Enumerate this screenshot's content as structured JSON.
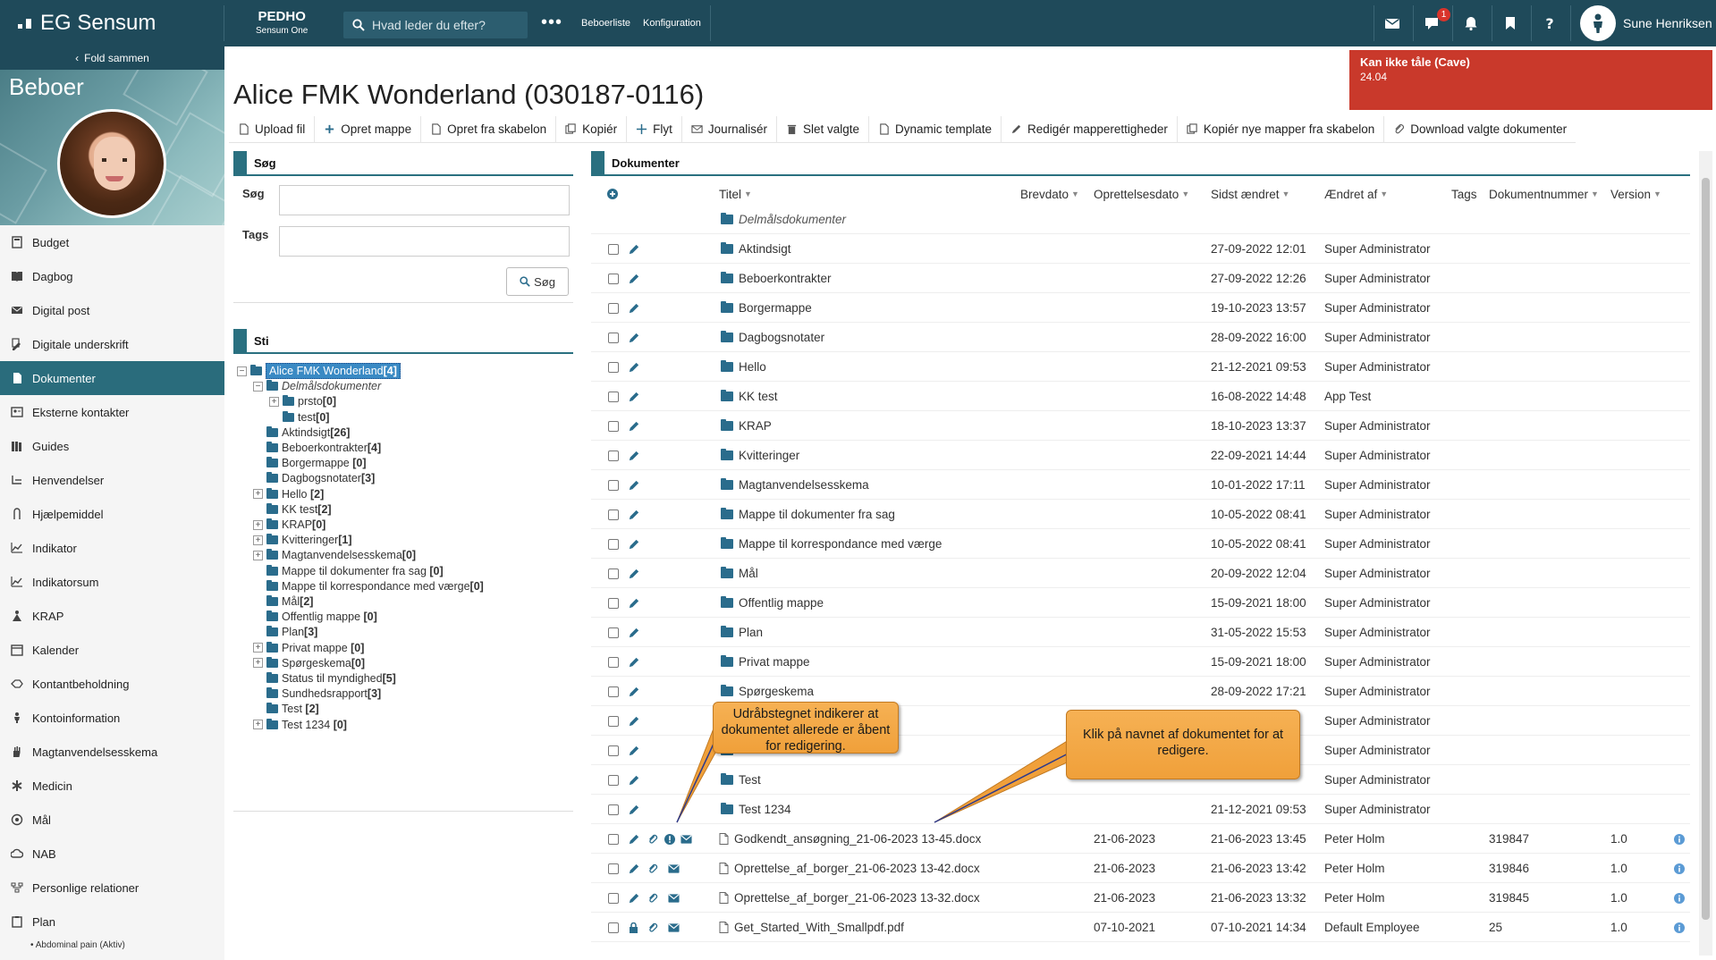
{
  "topbar": {
    "logo": "EG Sensum",
    "product_name": "PEDHO",
    "product_sub": "Sensum One",
    "search_placeholder": "Hvad leder du efter?",
    "more": "•••",
    "nav": [
      "Beboerliste",
      "Konfiguration"
    ],
    "chat_badge": "1",
    "user_name": "Sune Henriksen"
  },
  "sidebar": {
    "collapse_label": "Fold sammen",
    "title": "Beboer",
    "items": [
      {
        "label": "Budget",
        "icon": "calculator-icon"
      },
      {
        "label": "Dagbog",
        "icon": "book-icon"
      },
      {
        "label": "Digital post",
        "icon": "envelope-icon"
      },
      {
        "label": "Digitale underskrift",
        "icon": "signature-icon"
      },
      {
        "label": "Dokumenter",
        "icon": "document-icon"
      },
      {
        "label": "Eksterne kontakter",
        "icon": "contact-card-icon"
      },
      {
        "label": "Guides",
        "icon": "books-icon"
      },
      {
        "label": "Henvendelser",
        "icon": "inquiry-icon"
      },
      {
        "label": "Hjælpemiddel",
        "icon": "aid-icon"
      },
      {
        "label": "Indikator",
        "icon": "line-chart-icon"
      },
      {
        "label": "Indikatorsum",
        "icon": "line-chart-icon"
      },
      {
        "label": "KRAP",
        "icon": "krap-icon"
      },
      {
        "label": "Kalender",
        "icon": "calendar-icon"
      },
      {
        "label": "Kontantbeholdning",
        "icon": "cash-icon"
      },
      {
        "label": "Kontoinformation",
        "icon": "person-icon"
      },
      {
        "label": "Magtanvendelsesskema",
        "icon": "hand-icon"
      },
      {
        "label": "Medicin",
        "icon": "asterisk-icon"
      },
      {
        "label": "Mål",
        "icon": "target-icon"
      },
      {
        "label": "NAB",
        "icon": "cloud-icon"
      },
      {
        "label": "Personlige relationer",
        "icon": "relations-icon"
      },
      {
        "label": "Plan",
        "icon": "clipboard-icon"
      }
    ],
    "active_index": 4,
    "subitem": "• Abdominal pain (Aktiv)"
  },
  "alert": {
    "title": "Kan ikke tåle (Cave)",
    "value": "24.04"
  },
  "page_title": "Alice FMK Wonderland (030187-0116)",
  "toolbar": [
    {
      "label": "Upload fil",
      "icon": "file-icon"
    },
    {
      "label": "Opret mappe",
      "icon": "plus-icon"
    },
    {
      "label": "Opret fra skabelon",
      "icon": "file-icon"
    },
    {
      "label": "Kopiér",
      "icon": "copy-icon"
    },
    {
      "label": "Flyt",
      "icon": "move-icon"
    },
    {
      "label": "Journalisér",
      "icon": "envelope-icon"
    },
    {
      "label": "Slet valgte",
      "icon": "trash-icon"
    },
    {
      "label": "Dynamic template",
      "icon": "file-icon"
    },
    {
      "label": "Redigér mapperettigheder",
      "icon": "pencil-icon"
    },
    {
      "label": "Kopiér nye mapper fra skabelon",
      "icon": "copy-icon"
    },
    {
      "label": "Download valgte dokumenter",
      "icon": "paperclip-icon"
    }
  ],
  "search_panel": {
    "title": "Søg",
    "label_search": "Søg",
    "label_tags": "Tags",
    "button": "Søg"
  },
  "sti_panel": {
    "title": "Sti",
    "tree": [
      {
        "label": "Alice FMK Wonderland",
        "count": "[4]",
        "level": 0,
        "exp": "-",
        "selected": true
      },
      {
        "label": "Delmålsdokumenter",
        "count": "",
        "level": 1,
        "exp": "-",
        "italic": true
      },
      {
        "label": "prsto",
        "count": "[0]",
        "level": 2,
        "exp": "+"
      },
      {
        "label": "test",
        "count": "[0]",
        "level": 2,
        "exp": ""
      },
      {
        "label": "Aktindsigt",
        "count": "[26]",
        "level": 1,
        "exp": ""
      },
      {
        "label": "Beboerkontrakter",
        "count": "[4]",
        "level": 1,
        "exp": ""
      },
      {
        "label": "Borgermappe ",
        "count": "[0]",
        "level": 1,
        "exp": ""
      },
      {
        "label": "Dagbogsnotater",
        "count": "[3]",
        "level": 1,
        "exp": ""
      },
      {
        "label": "Hello ",
        "count": "[2]",
        "level": 1,
        "exp": "+"
      },
      {
        "label": "KK test",
        "count": "[2]",
        "level": 1,
        "exp": ""
      },
      {
        "label": "KRAP",
        "count": "[0]",
        "level": 1,
        "exp": "+"
      },
      {
        "label": "Kvitteringer",
        "count": "[1]",
        "level": 1,
        "exp": "+"
      },
      {
        "label": "Magtanvendelsesskema",
        "count": "[0]",
        "level": 1,
        "exp": "+"
      },
      {
        "label": "Mappe til dokumenter fra sag ",
        "count": "[0]",
        "level": 1,
        "exp": ""
      },
      {
        "label": "Mappe til korrespondance med værge",
        "count": "[0]",
        "level": 1,
        "exp": ""
      },
      {
        "label": "Mål",
        "count": "[2]",
        "level": 1,
        "exp": ""
      },
      {
        "label": "Offentlig mappe ",
        "count": "[0]",
        "level": 1,
        "exp": ""
      },
      {
        "label": "Plan",
        "count": "[3]",
        "level": 1,
        "exp": ""
      },
      {
        "label": "Privat mappe ",
        "count": "[0]",
        "level": 1,
        "exp": "+"
      },
      {
        "label": "Spørgeskema",
        "count": "[0]",
        "level": 1,
        "exp": "+"
      },
      {
        "label": "Status til myndighed",
        "count": "[5]",
        "level": 1,
        "exp": ""
      },
      {
        "label": "Sundhedsrapport",
        "count": "[3]",
        "level": 1,
        "exp": ""
      },
      {
        "label": "Test ",
        "count": "[2]",
        "level": 1,
        "exp": ""
      },
      {
        "label": "Test 1234 ",
        "count": "[0]",
        "level": 1,
        "exp": "+"
      }
    ]
  },
  "documents": {
    "title": "Dokumenter",
    "columns": [
      "Titel",
      "Brevdato",
      "Oprettelsesdato",
      "Sidst ændret",
      "Ændret af",
      "Tags",
      "Dokumentnummer",
      "Version"
    ],
    "rows": [
      {
        "type": "folder-italic",
        "title": "Delmålsdokumenter",
        "brevdato": "",
        "sidst": "",
        "af": "",
        "nr": "",
        "ver": ""
      },
      {
        "type": "folder",
        "title": "Aktindsigt",
        "brevdato": "",
        "sidst": "27-09-2022 12:01",
        "af": "Super Administrator",
        "nr": "",
        "ver": ""
      },
      {
        "type": "folder",
        "title": "Beboerkontrakter",
        "brevdato": "",
        "sidst": "27-09-2022 12:26",
        "af": "Super Administrator",
        "nr": "",
        "ver": ""
      },
      {
        "type": "folder",
        "title": "Borgermappe",
        "brevdato": "",
        "sidst": "19-10-2023 13:57",
        "af": "Super Administrator",
        "nr": "",
        "ver": ""
      },
      {
        "type": "folder",
        "title": "Dagbogsnotater",
        "brevdato": "",
        "sidst": "28-09-2022 16:00",
        "af": "Super Administrator",
        "nr": "",
        "ver": ""
      },
      {
        "type": "folder",
        "title": "Hello",
        "brevdato": "",
        "sidst": "21-12-2021 09:53",
        "af": "Super Administrator",
        "nr": "",
        "ver": ""
      },
      {
        "type": "folder",
        "title": "KK test",
        "brevdato": "",
        "sidst": "16-08-2022 14:48",
        "af": "App Test",
        "nr": "",
        "ver": ""
      },
      {
        "type": "folder",
        "title": "KRAP",
        "brevdato": "",
        "sidst": "18-10-2023 13:37",
        "af": "Super Administrator",
        "nr": "",
        "ver": ""
      },
      {
        "type": "folder",
        "title": "Kvitteringer",
        "brevdato": "",
        "sidst": "22-09-2021 14:44",
        "af": "Super Administrator",
        "nr": "",
        "ver": ""
      },
      {
        "type": "folder",
        "title": "Magtanvendelsesskema",
        "brevdato": "",
        "sidst": "10-01-2022 17:11",
        "af": "Super Administrator",
        "nr": "",
        "ver": ""
      },
      {
        "type": "folder",
        "title": "Mappe til dokumenter fra sag",
        "brevdato": "",
        "sidst": "10-05-2022 08:41",
        "af": "Super Administrator",
        "nr": "",
        "ver": ""
      },
      {
        "type": "folder",
        "title": "Mappe til korrespondance med værge",
        "brevdato": "",
        "sidst": "10-05-2022 08:41",
        "af": "Super Administrator",
        "nr": "",
        "ver": ""
      },
      {
        "type": "folder",
        "title": "Mål",
        "brevdato": "",
        "sidst": "20-09-2022 12:04",
        "af": "Super Administrator",
        "nr": "",
        "ver": ""
      },
      {
        "type": "folder",
        "title": "Offentlig mappe",
        "brevdato": "",
        "sidst": "15-09-2021 18:00",
        "af": "Super Administrator",
        "nr": "",
        "ver": ""
      },
      {
        "type": "folder",
        "title": "Plan",
        "brevdato": "",
        "sidst": "31-05-2022 15:53",
        "af": "Super Administrator",
        "nr": "",
        "ver": ""
      },
      {
        "type": "folder",
        "title": "Privat mappe",
        "brevdato": "",
        "sidst": "15-09-2021 18:00",
        "af": "Super Administrator",
        "nr": "",
        "ver": ""
      },
      {
        "type": "folder",
        "title": "Spørgeskema",
        "brevdato": "",
        "sidst": "28-09-2022 17:21",
        "af": "Super Administrator",
        "nr": "",
        "ver": ""
      },
      {
        "type": "folder",
        "title": "",
        "brevdato": "",
        "sidst": "",
        "af": "Super Administrator",
        "nr": "",
        "ver": ""
      },
      {
        "type": "folder",
        "title": "",
        "brevdato": "",
        "sidst": "",
        "af": "Super Administrator",
        "nr": "",
        "ver": ""
      },
      {
        "type": "folder",
        "title": "Test",
        "brevdato": "",
        "sidst": "",
        "af": "Super Administrator",
        "nr": "",
        "ver": ""
      },
      {
        "type": "folder",
        "title": "Test 1234",
        "brevdato": "",
        "sidst": "21-12-2021 09:53",
        "af": "Super Administrator",
        "nr": "",
        "ver": ""
      },
      {
        "type": "file",
        "title": "Godkendt_ansøgning_21-06-2023 13-45.docx",
        "brevdato": "21-06-2023",
        "sidst": "21-06-2023 13:45",
        "af": "Peter Holm",
        "nr": "319847",
        "ver": "1.0",
        "alert": true
      },
      {
        "type": "file",
        "title": "Oprettelse_af_borger_21-06-2023 13-42.docx",
        "brevdato": "21-06-2023",
        "sidst": "21-06-2023 13:42",
        "af": "Peter Holm",
        "nr": "319846",
        "ver": "1.0"
      },
      {
        "type": "file",
        "title": "Oprettelse_af_borger_21-06-2023 13-32.docx",
        "brevdato": "21-06-2023",
        "sidst": "21-06-2023 13:32",
        "af": "Peter Holm",
        "nr": "319845",
        "ver": "1.0"
      },
      {
        "type": "file",
        "title": "Get_Started_With_Smallpdf.pdf",
        "brevdato": "07-10-2021",
        "sidst": "07-10-2021 14:34",
        "af": "Default Employee",
        "nr": "25",
        "ver": "1.0",
        "locked": true
      }
    ]
  },
  "callouts": {
    "left": "Udråbstegnet indikerer at dokumentet allerede er åbent for redigering.",
    "right": "Klik på navnet af dokumentet for at redigere."
  },
  "colors": {
    "topbar": "#1f4a5a",
    "accent": "#2a7080",
    "alert": "#c9392b",
    "callout": "#f0a03a",
    "folder": "#2a6c8c"
  }
}
